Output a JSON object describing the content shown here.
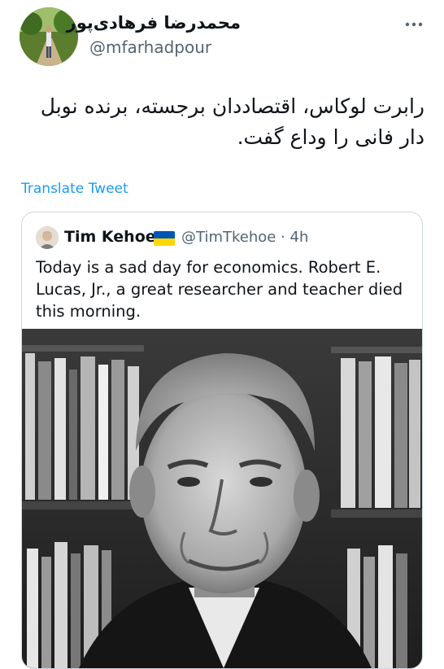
{
  "author": {
    "display_name": "محمدرضا فرهادی‌پور",
    "handle": "@mfarhadpour"
  },
  "tweet": {
    "text": "رابرت لوکاس، اقتصاددان برجسته، برنده نوبل دار فانی را وداع گفت."
  },
  "translate_label": "Translate Tweet",
  "quoted": {
    "name": "Tim Kehoe",
    "flag": "ukraine-flag-icon",
    "handle_time": "@TimTkehoe · 4h",
    "text": "Today is a sad day for economics. Robert E. Lucas, Jr., a great researcher and teacher died this morning."
  },
  "colors": {
    "link": "#1d9bf0",
    "secondary_text": "#536471",
    "border": "#cfd9de",
    "flag_blue": "#0057b7",
    "flag_yellow": "#ffd700"
  },
  "icons": [
    "more-options-icon",
    "ukraine-flag-icon"
  ]
}
